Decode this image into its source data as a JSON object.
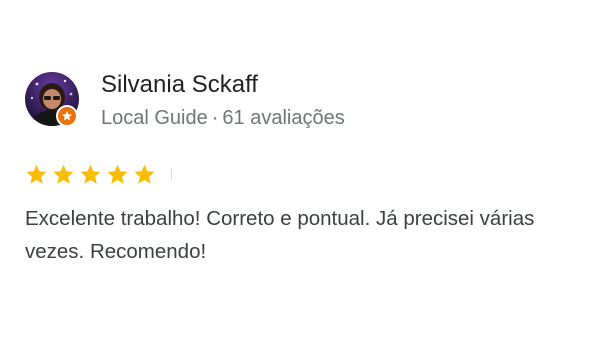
{
  "review": {
    "reviewer_name": "Silvania Sckaff",
    "reviewer_badge": "Local Guide",
    "meta_separator": "·",
    "reviews_count_text": "61 avaliações",
    "rating": 5,
    "rating_max": 5,
    "text": "Excelente trabalho! Correto e pontual. Já precisei várias vezes. Recomendo!"
  },
  "icons": {
    "avatar": "avatar-photo",
    "badge": "local-guide-badge-icon",
    "star": "star-icon"
  },
  "colors": {
    "star_filled": "#fbbc04",
    "badge_orange": "#e8710a",
    "name_text": "#202124",
    "meta_text": "#70757a",
    "body_text": "#3c4043"
  }
}
